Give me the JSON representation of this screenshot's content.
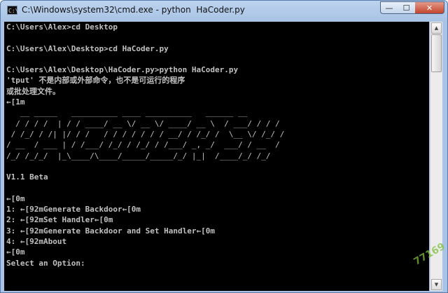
{
  "window": {
    "title": "C:\\Windows\\system32\\cmd.exe - python  HaCoder.py",
    "app_icon_label": "C:\\",
    "minimize_glyph": "—",
    "maximize_glyph": "☐",
    "close_glyph": "✕"
  },
  "console": {
    "lines_before_banner": [
      "C:\\Users\\Alex>cd Desktop",
      "",
      "C:\\Users\\Alex\\Desktop>cd HaCoder.py",
      "",
      "C:\\Users\\Alex\\Desktop\\HaCoder.py>python HaCoder.py",
      "'tput' 不是内部或外部命令，也不是可运行的程序",
      "或批处理文件。",
      "←[1m"
    ],
    "banner_lines": [
      "   __ _____   __________ ____ __________   ______ __",
      "  / / / /  | / / ____/ __ \\/ __ \\/ ____/ __ \\  / ___/ / / /",
      " / /_/ / /| |/ / /   / / / / / / / __/ / /_/ /  \\__ \\/ /_/ /",
      "/ __  / ___ | / /___/ /_/ / /_/ / /___/ _, _/  ___/ / __  /",
      "/_/ /_/_/  |_\\____/\\____/_____/_____/_/ |_|  /____/_/ /_/"
    ],
    "lines_after_banner": [
      "",
      "V1.1 Beta",
      "",
      "←[0m",
      "1: ←[92mGenerate Backdoor←[0m",
      "2: ←[92mSet Handler←[0m",
      "3: ←[92mGenerate Backdoor and Set Handler←[0m",
      "4: ←[92mAbout",
      "←[0m",
      "Select an Option:"
    ]
  },
  "scrollbar": {
    "up_glyph": "▲",
    "down_glyph": "▼"
  },
  "watermark": {
    "text": "77169"
  }
}
